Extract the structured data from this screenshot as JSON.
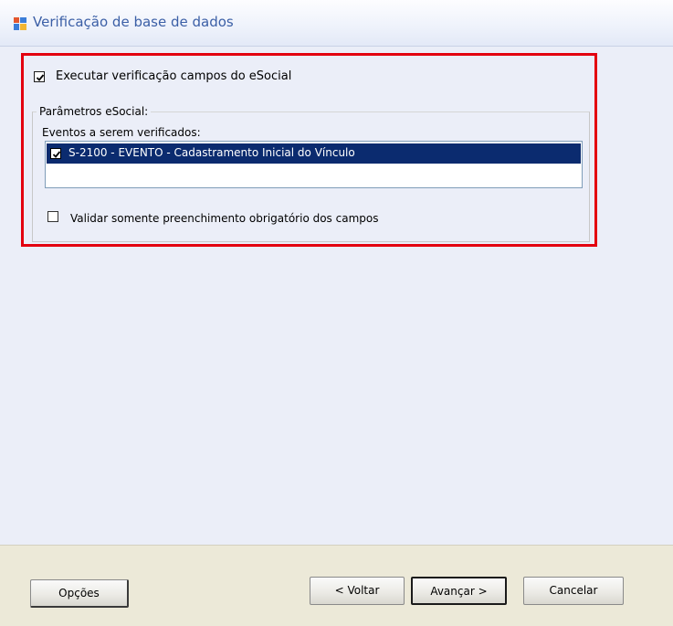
{
  "window": {
    "title": "Verificação de base de dados"
  },
  "esocial": {
    "execute_checkbox_label": "Executar verificação campos do eSocial",
    "execute_checked": true,
    "group_label": "Parâmetros eSocial:",
    "events_label": "Eventos a serem verificados:",
    "events": [
      {
        "label": "S-2100 - EVENTO - Cadastramento Inicial do Vínculo",
        "checked": true,
        "selected": true
      }
    ],
    "validate_required_label": "Validar somente preenchimento obrigatório dos campos",
    "validate_required_checked": false
  },
  "buttons": {
    "options": "Opções",
    "back": "< Voltar",
    "next": "Avançar >",
    "cancel": "Cancelar"
  },
  "colors": {
    "highlight_frame": "#e3000f",
    "selection": "#0b2b6f",
    "title_text": "#3b5fa6"
  }
}
